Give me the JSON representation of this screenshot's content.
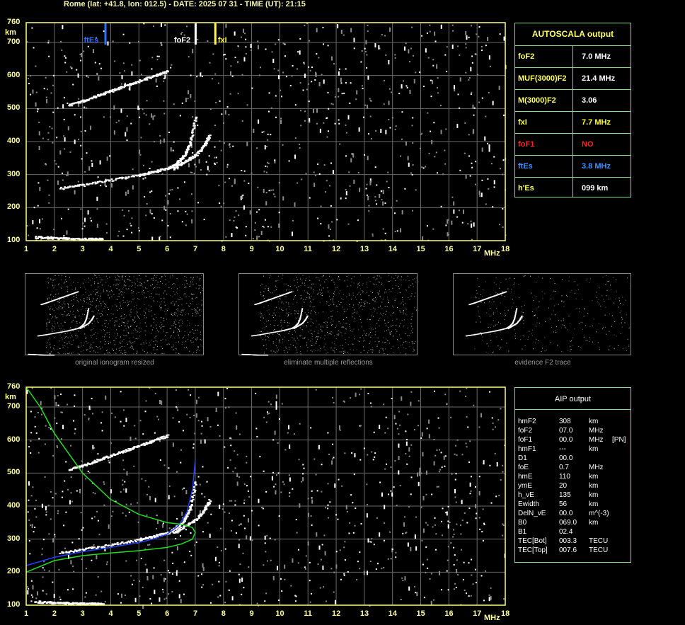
{
  "header": "Rome (lat: +41.8, lon: 012.5) - DATE: 2025 07 31 - TIME (UT): 21:15",
  "chart_data": [
    {
      "type": "scatter",
      "title": "",
      "xlabel": "MHz",
      "ylabel": "km",
      "xlim": [
        1,
        18
      ],
      "ylim": [
        100,
        760
      ],
      "x_ticks": [
        "1",
        "2",
        "3",
        "4",
        "5",
        "6",
        "7",
        "8",
        "9",
        "10",
        "11",
        "12",
        "13",
        "14",
        "15",
        "16",
        "17",
        "18"
      ],
      "y_ticks": [
        "100",
        "200",
        "300",
        "400",
        "500",
        "600",
        "700",
        "760"
      ],
      "grid": true,
      "markers": [
        {
          "label": "ftEs",
          "x": 3.8,
          "color": "#2f6fff"
        },
        {
          "label": "foF2",
          "x": 7.0,
          "color": "#ffffff"
        },
        {
          "label": "fxI",
          "x": 7.7,
          "color": "#ffff33"
        }
      ],
      "series": [
        {
          "x": [
            2.2,
            3,
            4,
            5,
            5.5,
            6,
            6.3,
            6.6,
            6.8,
            7.0
          ],
          "y": [
            260,
            270,
            285,
            300,
            310,
            320,
            335,
            360,
            400,
            480
          ]
        },
        {
          "x": [
            6.2,
            6.6,
            7.0,
            7.3,
            7.5
          ],
          "y": [
            320,
            340,
            360,
            390,
            420
          ]
        },
        {
          "x": [
            2.5,
            3,
            3.5,
            4,
            4.5,
            5,
            5.5,
            6
          ],
          "y": [
            512,
            525,
            540,
            555,
            570,
            585,
            600,
            615
          ]
        },
        {
          "x": [
            1.3,
            1.8,
            2.3,
            2.8,
            3.3,
            3.7
          ],
          "y": [
            112,
            110,
            108,
            106,
            106,
            106
          ]
        }
      ]
    },
    {
      "type": "scatter",
      "title": "",
      "xlabel": "MHz",
      "ylabel": "km",
      "xlim": [
        1,
        18
      ],
      "ylim": [
        100,
        760
      ],
      "x_ticks": [
        "1",
        "2",
        "3",
        "4",
        "5",
        "6",
        "7",
        "8",
        "9",
        "10",
        "11",
        "12",
        "13",
        "14",
        "15",
        "16",
        "17",
        "18"
      ],
      "y_ticks": [
        "100",
        "200",
        "300",
        "400",
        "500",
        "600",
        "700",
        "760"
      ],
      "grid": true,
      "series": [
        {
          "x": [
            2.2,
            3,
            4,
            5,
            5.5,
            6,
            6.3,
            6.6,
            6.8,
            7.0
          ],
          "y": [
            260,
            270,
            285,
            300,
            310,
            320,
            335,
            360,
            400,
            480
          ]
        },
        {
          "x": [
            6.2,
            6.6,
            7.0,
            7.3,
            7.5
          ],
          "y": [
            320,
            340,
            360,
            390,
            420
          ]
        },
        {
          "x": [
            2.5,
            3,
            3.5,
            4,
            4.5,
            5,
            5.5,
            6
          ],
          "y": [
            512,
            525,
            540,
            555,
            570,
            585,
            600,
            615
          ]
        },
        {
          "x": [
            1.3,
            1.8,
            2.3,
            2.8,
            3.3,
            3.7
          ],
          "y": [
            112,
            110,
            108,
            106,
            106,
            106
          ]
        },
        {
          "color": "#2040ff",
          "x": [
            1,
            2,
            3,
            4,
            5,
            5.5,
            6,
            6.4,
            6.7,
            6.9,
            7.0
          ],
          "y": [
            220,
            245,
            262,
            275,
            290,
            300,
            315,
            340,
            380,
            450,
            540
          ]
        },
        {
          "color": "#22dd22",
          "x": [
            1,
            2,
            3,
            4,
            5,
            6,
            6.5,
            6.9,
            7.0,
            6.9,
            6.5,
            6,
            5,
            4,
            3,
            2,
            1.5,
            1
          ],
          "y": [
            200,
            235,
            250,
            258,
            265,
            275,
            285,
            300,
            320,
            335,
            345,
            350,
            375,
            420,
            500,
            620,
            700,
            760
          ]
        }
      ]
    }
  ],
  "thumbnails": [
    {
      "caption": "original ionogram resized"
    },
    {
      "caption": "eliminate multiple reflections"
    },
    {
      "caption": "evidence F2 trace"
    }
  ],
  "autoscala": {
    "title": "AUTOSCALA output",
    "rows": [
      {
        "key": "foF2",
        "value": "7.0 MHz",
        "color": "#ffffff"
      },
      {
        "key": "MUF(3000)F2",
        "value": "21.4 MHz",
        "color": "#ffffff"
      },
      {
        "key": "M(3000)F2",
        "value": "3.06",
        "color": "#ffffff"
      },
      {
        "key": "fxI",
        "value": "7.7 MHz",
        "color": "#ffff33"
      },
      {
        "key": "foF1",
        "value": "NO",
        "color": "#ff2020"
      },
      {
        "key": "ftEs",
        "value": "3.8 MHz",
        "color": "#3f8fff"
      },
      {
        "key": "h'Es",
        "value": "099    km",
        "color": "#ffffff"
      }
    ]
  },
  "aip": {
    "title": "AIP output",
    "rows": [
      {
        "key": "hmF2",
        "value": "308",
        "unit": "km",
        "extra": ""
      },
      {
        "key": "foF2",
        "value": "07.0",
        "unit": "MHz",
        "extra": ""
      },
      {
        "key": "foF1",
        "value": "00.0",
        "unit": "MHz",
        "extra": "[PN]"
      },
      {
        "key": "hmF1",
        "value": "---",
        "unit": "km",
        "extra": ""
      },
      {
        "key": "D1",
        "value": "00.0",
        "unit": "",
        "extra": ""
      },
      {
        "key": "foE",
        "value": "0.7",
        "unit": "MHz",
        "extra": ""
      },
      {
        "key": "hmE",
        "value": "110",
        "unit": "km",
        "extra": ""
      },
      {
        "key": "ymE",
        "value": "20",
        "unit": "km",
        "extra": ""
      },
      {
        "key": "h_vE",
        "value": "135",
        "unit": "km",
        "extra": ""
      },
      {
        "key": "Ewidth",
        "value": "56",
        "unit": "km",
        "extra": ""
      },
      {
        "key": "DelN_vE",
        "value": "00.0",
        "unit": "m^(-3)",
        "extra": ""
      },
      {
        "key": "B0",
        "value": "069.0",
        "unit": "km",
        "extra": ""
      },
      {
        "key": "B1",
        "value": "02.4",
        "unit": "",
        "extra": ""
      },
      {
        "key": "TEC[Bot]",
        "value": "003.3",
        "unit": "TECU",
        "extra": ""
      },
      {
        "key": "TEC[Top]",
        "value": "007.6",
        "unit": "TECU",
        "extra": ""
      }
    ]
  }
}
